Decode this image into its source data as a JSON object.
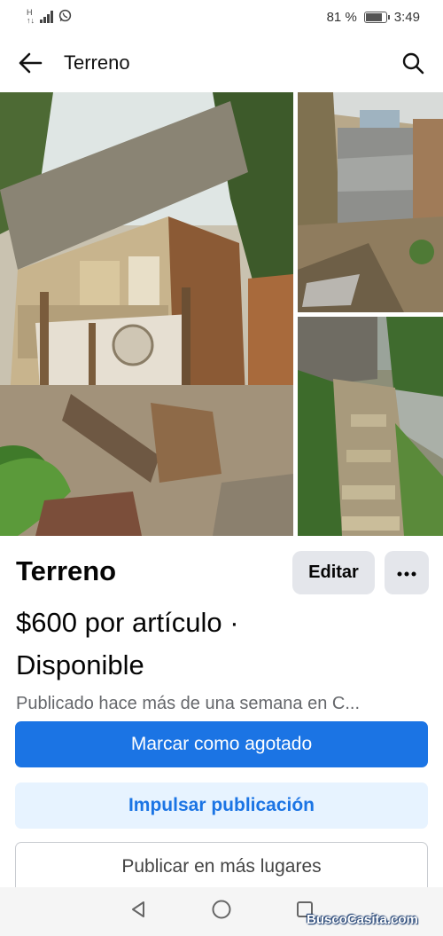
{
  "status_bar": {
    "battery_percent": "81 %",
    "time": "3:49",
    "battery_level": 0.81
  },
  "app_bar": {
    "title": "Terreno",
    "back_icon": "arrow-left-icon",
    "search_icon": "search-icon"
  },
  "listing": {
    "title": "Terreno",
    "edit_label": "Editar",
    "more_icon": "more-horizontal-icon",
    "price_line": "$600 por artículo ·",
    "availability": "Disponible",
    "published": "Publicado hace más de una semana en C..."
  },
  "actions": {
    "mark_sold": "Marcar como agotado",
    "boost": "Impulsar publicación",
    "publish_more": "Publicar en más lugares"
  },
  "colors": {
    "primary": "#1b74e4",
    "secondary_bg": "#e7f3ff",
    "neutral_btn": "#e4e6eb",
    "muted_text": "#65676b"
  },
  "watermark": "BuscoCasita.com"
}
